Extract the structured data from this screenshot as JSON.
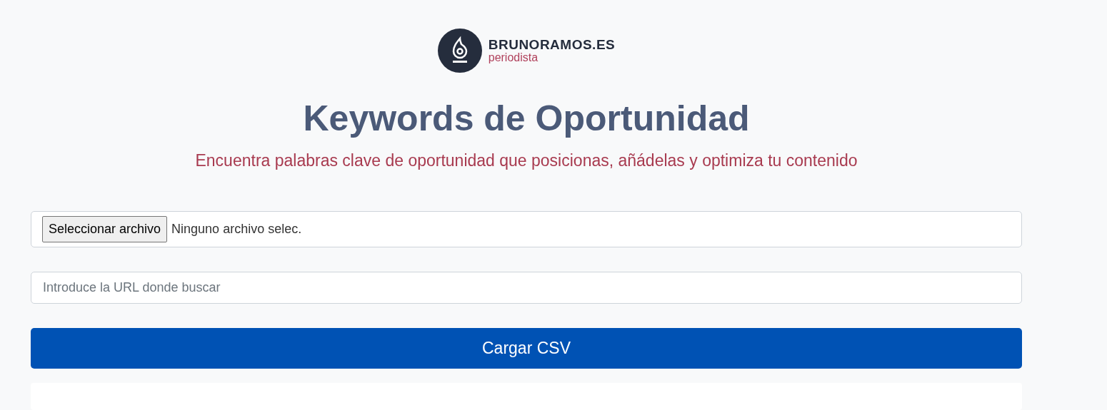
{
  "logo": {
    "name": "BRUNORAMOS.ES",
    "tagline": "periodista"
  },
  "title": "Keywords de Oportunidad",
  "subtitle": "Encuentra palabras clave de oportunidad que posicionas, añádelas y optimiza tu contenido",
  "file_input": {
    "button": "Seleccionar archivo",
    "status": "Ninguno archivo selec."
  },
  "url_input": {
    "placeholder": "Introduce la URL donde buscar"
  },
  "submit_button": "Cargar CSV"
}
